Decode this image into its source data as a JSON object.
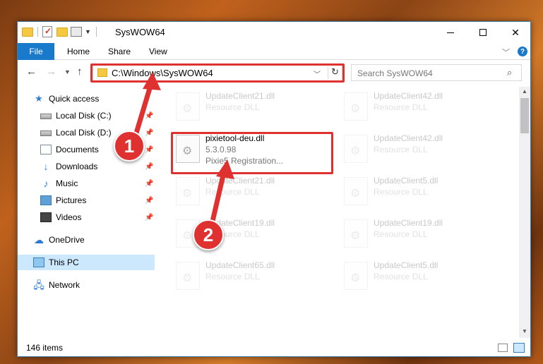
{
  "window": {
    "title": "SysWOW64",
    "controls": {
      "minimize": "minimize-icon",
      "maximize": "maximize-icon",
      "close": "✕"
    }
  },
  "ribbon": {
    "tabs": [
      "File",
      "Home",
      "Share",
      "View"
    ],
    "help": "?"
  },
  "address_bar": {
    "path": "C:\\Windows\\SysWOW64",
    "search_placeholder": "Search SysWOW64"
  },
  "sidebar": {
    "items": [
      {
        "label": "Quick access",
        "icon": "star-icon"
      },
      {
        "label": "Local Disk (C:)",
        "icon": "disk-icon",
        "pinned": true
      },
      {
        "label": "Local Disk (D:)",
        "icon": "disk-icon",
        "pinned": true
      },
      {
        "label": "Documents",
        "icon": "documents-icon",
        "pinned": true
      },
      {
        "label": "Downloads",
        "icon": "downloads-icon",
        "pinned": true
      },
      {
        "label": "Music",
        "icon": "music-icon",
        "pinned": true
      },
      {
        "label": "Pictures",
        "icon": "pictures-icon",
        "pinned": true
      },
      {
        "label": "Videos",
        "icon": "videos-icon",
        "pinned": true
      },
      {
        "label": "OneDrive",
        "icon": "cloud-icon"
      },
      {
        "label": "This PC",
        "icon": "pc-icon",
        "selected": true
      },
      {
        "label": "Network",
        "icon": "network-icon"
      }
    ]
  },
  "files": [
    {
      "name": "UpdateClient21.dll",
      "desc": "Resource DLL",
      "faded": true
    },
    {
      "name": "UpdateClient42.dll",
      "desc": "Resource DLL",
      "faded": true
    },
    {
      "name": "UpdateClient42.dll",
      "desc": "Resource DLL",
      "faded": true
    },
    {
      "name": "pixietool-deu.dll",
      "version": "5.3.0.98",
      "desc": "Pixie5 Registration...",
      "faded": false
    },
    {
      "name": "UpdateClient21.dll",
      "desc": "Resource DLL",
      "faded": true
    },
    {
      "name": "UpdateClient5.dll",
      "desc": "Resource DLL",
      "faded": true
    },
    {
      "name": "UpdateClient19.dll",
      "desc": "Resource DLL",
      "faded": true
    },
    {
      "name": "UpdateClient19.dll",
      "desc": "Resource DLL",
      "faded": true
    },
    {
      "name": "UpdateClient65.dll",
      "desc": "Resource DLL",
      "faded": true
    },
    {
      "name": "UpdateClient5.dll",
      "desc": "Resource DLL",
      "faded": true
    }
  ],
  "status": {
    "item_count": "146 items"
  },
  "annotations": {
    "step1": "1",
    "step2": "2",
    "color": "#e03131"
  }
}
